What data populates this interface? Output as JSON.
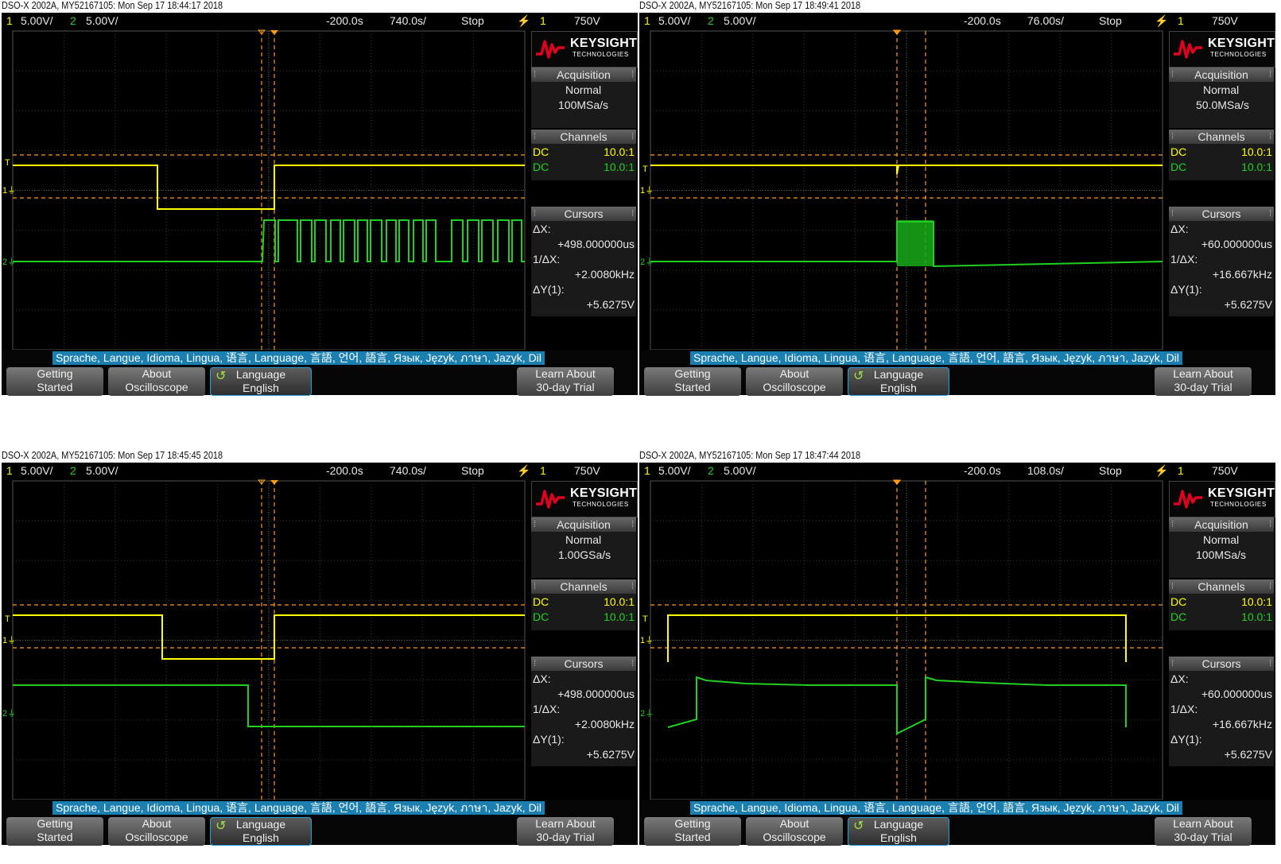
{
  "language_bar": "Sprache, Langue, Idioma, Lingua, 语言, Language, 言語, 언어, 語言, Язык, Język, ภาษา, Jazyk, Dil",
  "softkeys": {
    "getting_started": [
      "Getting",
      "Started"
    ],
    "about": [
      "About",
      "Oscilloscope"
    ],
    "language": [
      "Language",
      "English"
    ],
    "learn": [
      "Learn About",
      "30-day Trial"
    ]
  },
  "brand": {
    "name": "KEYSIGHT",
    "sub": "TECHNOLOGIES"
  },
  "colors": {
    "ch1": "#ffff00",
    "ch2": "#20d020",
    "cursor": "#ff9a1a",
    "grid": "#3c3c3c",
    "accent": "#1b7fb0"
  },
  "screens": [
    {
      "title": "DSO-X 2002A, MY52167105: Mon Sep 17 18:44:17 2018",
      "status": {
        "ch1_num": "1",
        "ch1_scale": "5.00V/",
        "ch2_num": "2",
        "ch2_scale": "5.00V/",
        "delay": "-200.0s",
        "timebase": "740.0s/",
        "run": "Stop",
        "trig_src": "1",
        "trig_level": "750V"
      },
      "acq": {
        "label": "Acquisition",
        "mode": "Normal",
        "rate": "100MSa/s"
      },
      "channels": {
        "label": "Channels",
        "rows": [
          {
            "coupling": "DC",
            "probe": "10.0:1"
          },
          {
            "coupling": "DC",
            "probe": "10.0:1"
          }
        ]
      },
      "cursors": {
        "label": "Cursors",
        "dx_label": "ΔX:",
        "dx": "+498.000000us",
        "inv_label": "1/ΔX:",
        "inv": "+2.0080kHz",
        "dy_label": "ΔY(1):",
        "dy": "+5.6275V"
      }
    },
    {
      "title": "DSO-X 2002A, MY52167105: Mon Sep 17 18:49:41 2018",
      "status": {
        "ch1_num": "1",
        "ch1_scale": "5.00V/",
        "ch2_num": "2",
        "ch2_scale": "5.00V/",
        "delay": "-200.0s",
        "timebase": "76.00s/",
        "run": "Stop",
        "trig_src": "1",
        "trig_level": "750V"
      },
      "acq": {
        "label": "Acquisition",
        "mode": "Normal",
        "rate": "50.0MSa/s"
      },
      "channels": {
        "label": "Channels",
        "rows": [
          {
            "coupling": "DC",
            "probe": "10.0:1"
          },
          {
            "coupling": "DC",
            "probe": "10.0:1"
          }
        ]
      },
      "cursors": {
        "label": "Cursors",
        "dx_label": "ΔX:",
        "dx": "+60.000000us",
        "inv_label": "1/ΔX:",
        "inv": "+16.667kHz",
        "dy_label": "ΔY(1):",
        "dy": "+5.6275V"
      }
    },
    {
      "title": "DSO-X 2002A, MY52167105: Mon Sep 17 18:45:45 2018",
      "status": {
        "ch1_num": "1",
        "ch1_scale": "5.00V/",
        "ch2_num": "2",
        "ch2_scale": "5.00V/",
        "delay": "-200.0s",
        "timebase": "740.0s/",
        "run": "Stop",
        "trig_src": "1",
        "trig_level": "750V"
      },
      "acq": {
        "label": "Acquisition",
        "mode": "Normal",
        "rate": "1.00GSa/s"
      },
      "channels": {
        "label": "Channels",
        "rows": [
          {
            "coupling": "DC",
            "probe": "10.0:1"
          },
          {
            "coupling": "DC",
            "probe": "10.0:1"
          }
        ]
      },
      "cursors": {
        "label": "Cursors",
        "dx_label": "ΔX:",
        "dx": "+498.000000us",
        "inv_label": "1/ΔX:",
        "inv": "+2.0080kHz",
        "dy_label": "ΔY(1):",
        "dy": "+5.6275V"
      }
    },
    {
      "title": "DSO-X 2002A, MY52167105: Mon Sep 17 18:47:44 2018",
      "status": {
        "ch1_num": "1",
        "ch1_scale": "5.00V/",
        "ch2_num": "2",
        "ch2_scale": "5.00V/",
        "delay": "-200.0s",
        "timebase": "108.0s/",
        "run": "Stop",
        "trig_src": "1",
        "trig_level": "750V"
      },
      "acq": {
        "label": "Acquisition",
        "mode": "Normal",
        "rate": "100MSa/s"
      },
      "channels": {
        "label": "Channels",
        "rows": [
          {
            "coupling": "DC",
            "probe": "10.0:1"
          },
          {
            "coupling": "DC",
            "probe": "10.0:1"
          }
        ]
      },
      "cursors": {
        "label": "Cursors",
        "dx_label": "ΔX:",
        "dx": "+60.000000us",
        "inv_label": "1/ΔX:",
        "inv": "+16.667kHz",
        "dy_label": "ΔY(1):",
        "dy": "+5.6275V"
      }
    }
  ]
}
